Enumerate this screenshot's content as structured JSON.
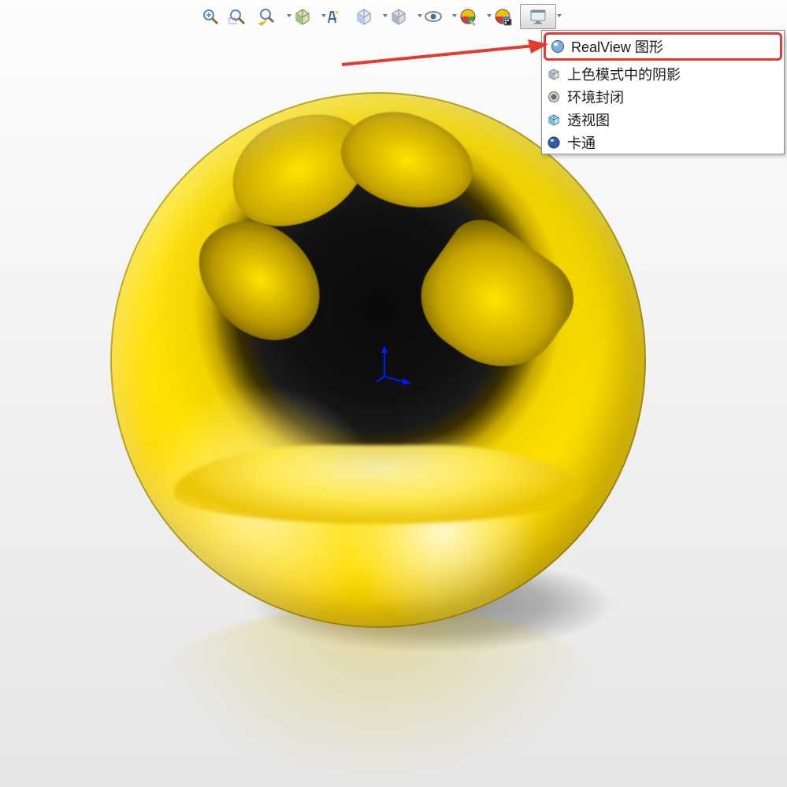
{
  "toolbar": {
    "buttons": [
      {
        "name": "zoom-fit-icon"
      },
      {
        "name": "zoom-window-icon"
      },
      {
        "name": "previous-view-icon"
      },
      {
        "name": "section-view-icon",
        "dropdown": true
      },
      {
        "name": "dynamic-annotation-icon"
      },
      {
        "name": "view-orientation-icon",
        "dropdown": true
      },
      {
        "name": "display-style-icon",
        "dropdown": true
      },
      {
        "name": "hide-show-icon",
        "dropdown": true
      },
      {
        "name": "edit-appearance-icon",
        "dropdown": true
      },
      {
        "name": "apply-scene-icon",
        "dropdown": true
      },
      {
        "name": "view-settings-icon",
        "dropdown": true,
        "active": true
      }
    ]
  },
  "menu": {
    "items": [
      {
        "label": "RealView 图形",
        "icon": "realview-sphere-icon",
        "highlight": true
      },
      {
        "label": "上色模式中的阴影",
        "icon": "shaded-cube-icon"
      },
      {
        "label": "环境封闭",
        "icon": "ambient-occlusion-icon"
      },
      {
        "label": "透视图",
        "icon": "perspective-box-icon"
      },
      {
        "label": "卡通",
        "icon": "cartoon-sphere-icon"
      }
    ]
  }
}
